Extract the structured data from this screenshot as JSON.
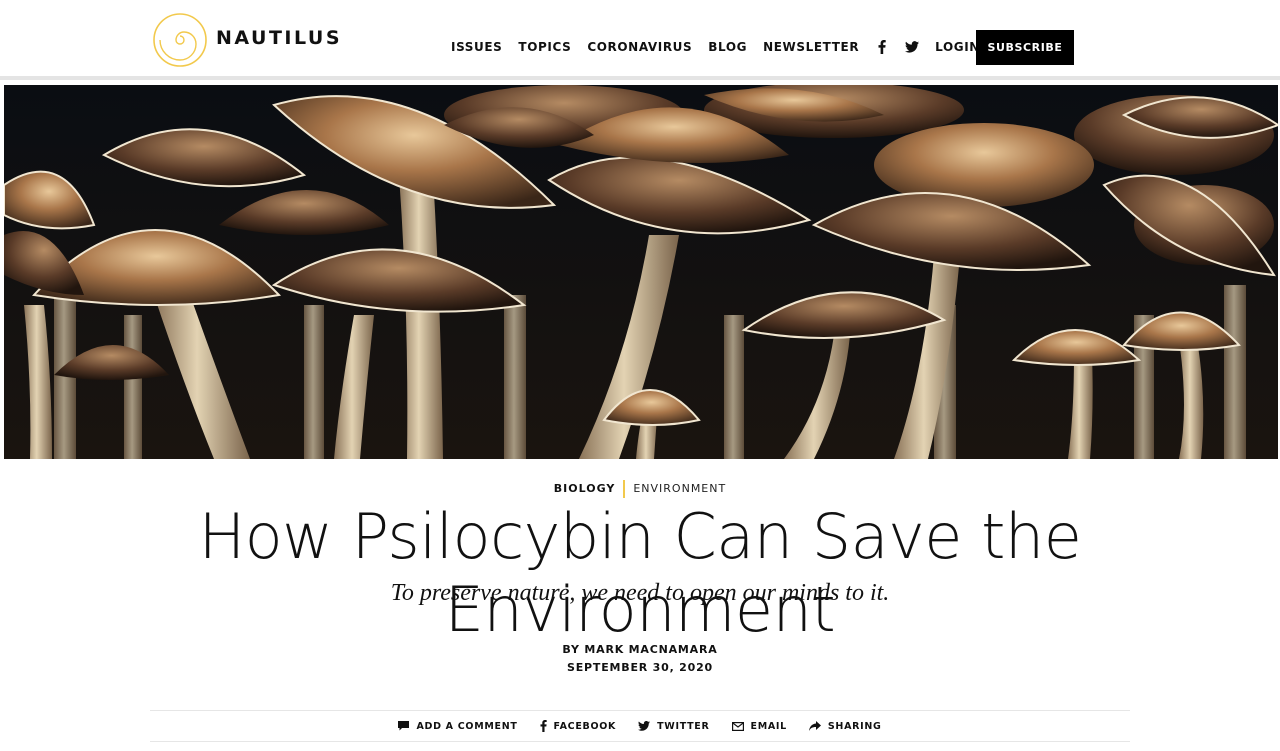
{
  "brand": {
    "name": "NAUTILUS",
    "logo_icon": "spiral-shell-icon",
    "accent": "#f2c94c"
  },
  "nav": {
    "items": [
      "ISSUES",
      "TOPICS",
      "CORONAVIRUS",
      "BLOG",
      "NEWSLETTER"
    ],
    "social_icons": [
      "facebook-icon",
      "twitter-icon"
    ],
    "login": "LOGIN",
    "subscribe": "SUBSCRIBE"
  },
  "hero": {
    "image": "psilocybin-mushrooms-photo"
  },
  "article": {
    "category_primary": "BIOLOGY",
    "category_secondary": "ENVIRONMENT",
    "title": "How Psilocybin Can Save the Environment",
    "subtitle": "To preserve nature, we need to open our minds to it.",
    "byline": "BY MARK MACNAMARA",
    "date": "SEPTEMBER 30, 2020"
  },
  "share": {
    "comment": "ADD A COMMENT",
    "facebook": "FACEBOOK",
    "twitter": "TWITTER",
    "email": "EMAIL",
    "sharing": "SHARING"
  }
}
